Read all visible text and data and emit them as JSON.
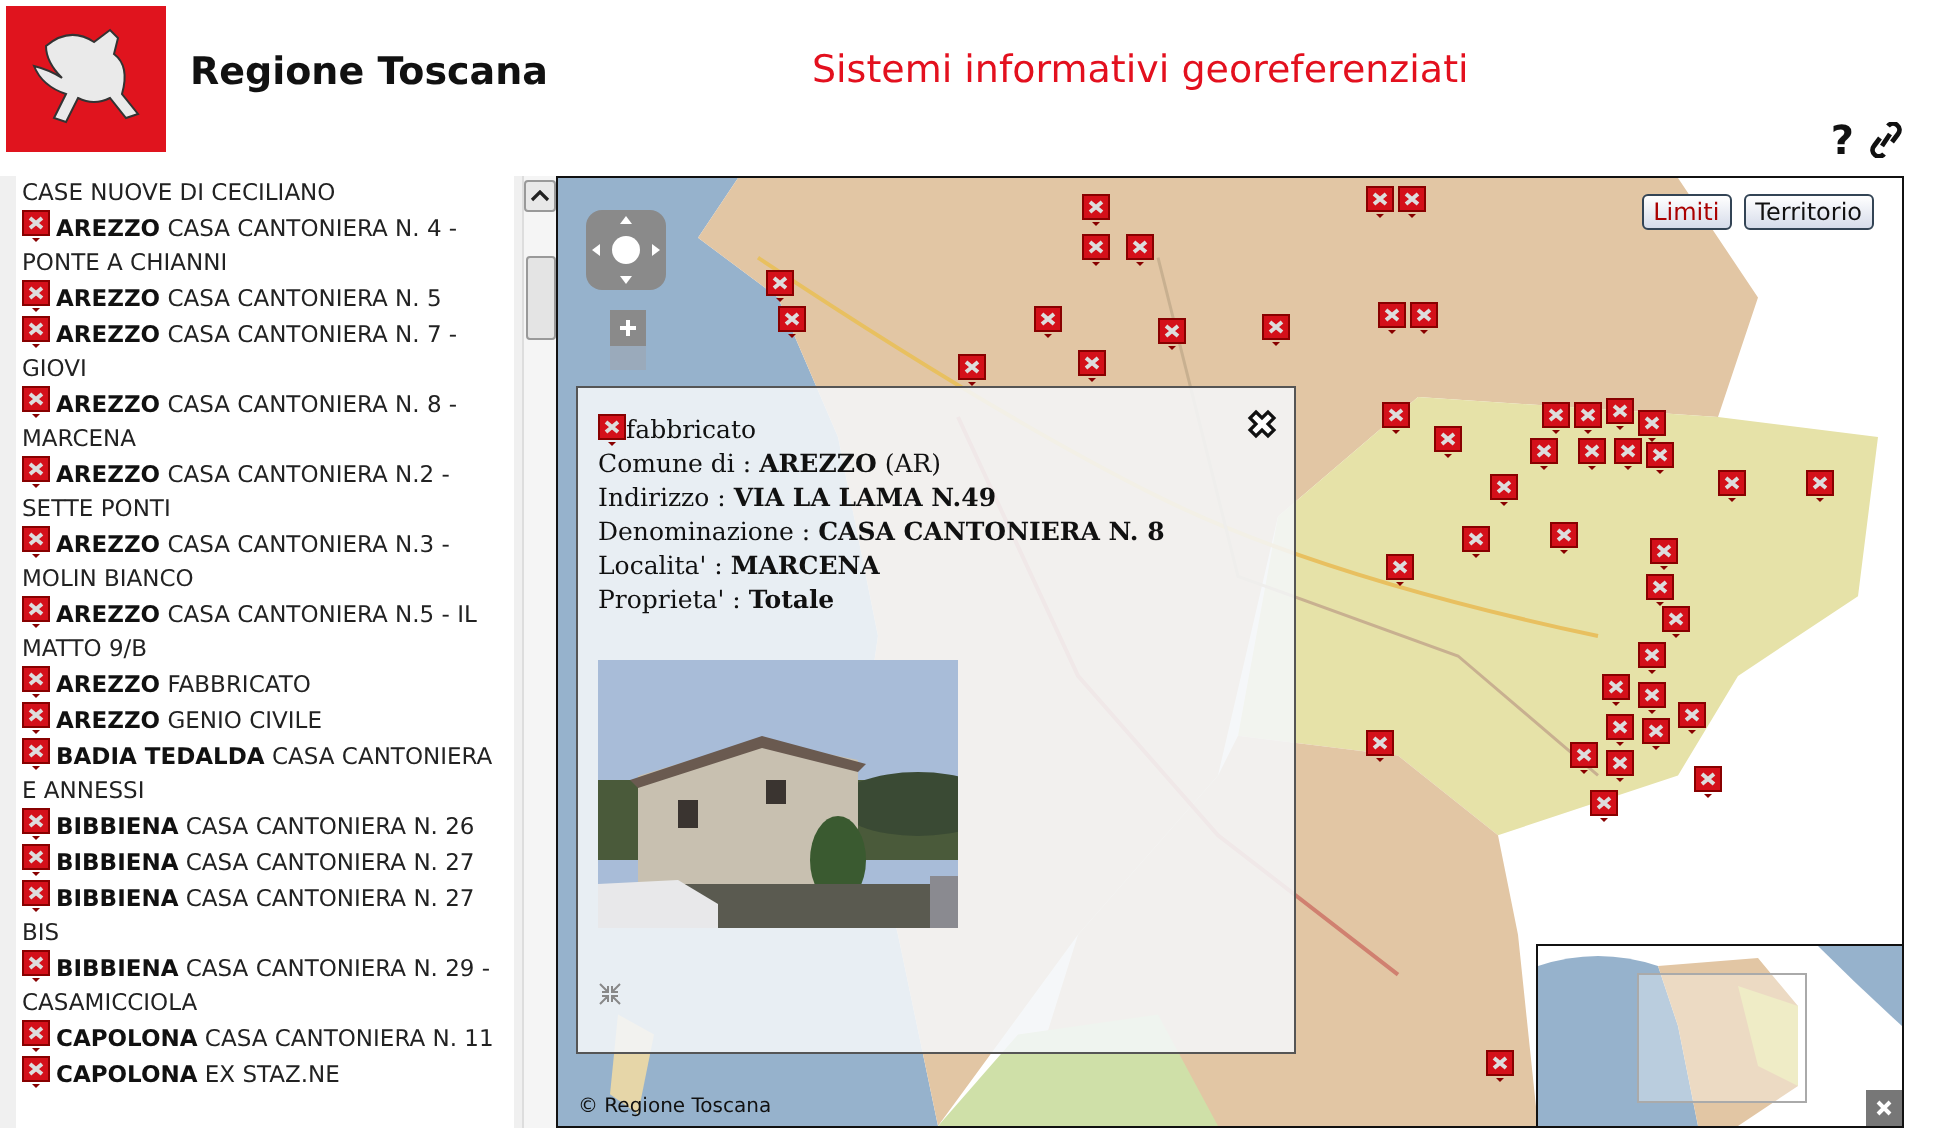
{
  "header": {
    "title": "Regione Toscana",
    "subtitle": "Sistemi informativi georeferenziati",
    "help": "?"
  },
  "list": {
    "items": [
      {
        "kind": "continuation",
        "text": "CASE NUOVE DI CECILIANO"
      },
      {
        "kind": "entry",
        "text": "**AREZZO** CASA CANTONIERA N. 4 - PONTE A CHIANNI"
      },
      {
        "kind": "entry",
        "text": "**AREZZO** CASA CANTONIERA N. 5"
      },
      {
        "kind": "entry",
        "text": "**AREZZO** CASA CANTONIERA N. 7 - GIOVI"
      },
      {
        "kind": "entry",
        "text": "**AREZZO** CASA CANTONIERA N. 8 - MARCENA"
      },
      {
        "kind": "entry",
        "text": "**AREZZO** CASA CANTONIERA N.2 - SETTE PONTI"
      },
      {
        "kind": "entry",
        "text": "**AREZZO** CASA CANTONIERA N.3 - MOLIN BIANCO"
      },
      {
        "kind": "entry",
        "text": "**AREZZO** CASA CANTONIERA N.5 - IL MATTO 9/B"
      },
      {
        "kind": "entry",
        "text": "**AREZZO** FABBRICATO"
      },
      {
        "kind": "entry",
        "text": "**AREZZO** GENIO CIVILE"
      },
      {
        "kind": "entry",
        "text": "**BADIA TEDALDA** CASA CANTONIERA E ANNESSI"
      },
      {
        "kind": "entry",
        "text": "**BIBBIENA** CASA CANTONIERA N. 26"
      },
      {
        "kind": "entry",
        "text": "**BIBBIENA** CASA CANTONIERA N. 27"
      },
      {
        "kind": "entry",
        "text": "**BIBBIENA** CASA CANTONIERA N. 27 BIS"
      },
      {
        "kind": "entry",
        "text": "**BIBBIENA** CASA CANTONIERA N. 29 - CASAMICCIOLA"
      },
      {
        "kind": "entry",
        "text": "**CAPOLONA** CASA CANTONIERA N. 11"
      },
      {
        "kind": "entry",
        "text": "**CAPOLONA** EX STAZ.NE"
      }
    ]
  },
  "map": {
    "layer_buttons": [
      {
        "label": "Limiti",
        "selected": true
      },
      {
        "label": "Territorio",
        "selected": false
      }
    ],
    "attribution": "© Regione Toscana",
    "popup": {
      "title": "fabbricato",
      "lines": [
        "Comune di : **AREZZO** (AR)",
        "Indirizzo : **VIA LA LAMA N.49**",
        "Denominazione : **CASA CANTONIERA N. 8**",
        "Localita' : **MARCENA**",
        "Proprieta' : **Totale**"
      ]
    }
  }
}
